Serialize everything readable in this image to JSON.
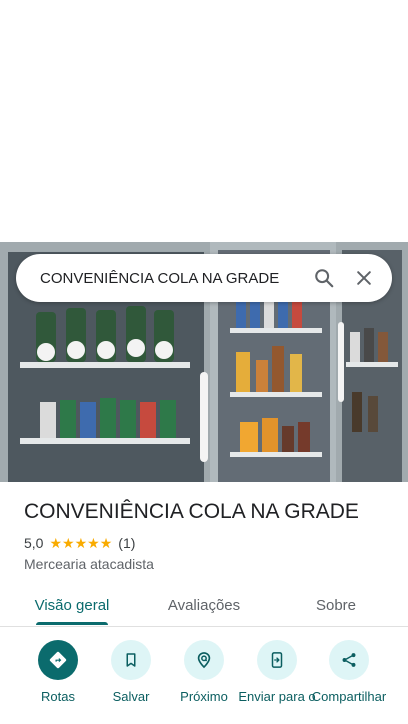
{
  "search": {
    "query": "CONVENIÊNCIA COLA NA GRADE"
  },
  "place": {
    "name": "CONVENIÊNCIA COLA NA GRADE",
    "rating": "5,0",
    "stars": 5,
    "review_count": "(1)",
    "category": "Mercearia atacadista"
  },
  "tabs": [
    {
      "label": "Visão geral",
      "active": true
    },
    {
      "label": "Avaliações",
      "active": false
    },
    {
      "label": "Sobre",
      "active": false
    }
  ],
  "actions": [
    {
      "label": "Rotas",
      "icon": "directions-icon"
    },
    {
      "label": "Salvar",
      "icon": "bookmark-icon"
    },
    {
      "label": "Próximo",
      "icon": "nearby-icon"
    },
    {
      "label": "Enviar para o",
      "icon": "send-to-phone-icon"
    },
    {
      "label": "Compartilhar",
      "icon": "share-icon"
    }
  ],
  "colors": {
    "accent": "#0b6b6d",
    "accent_light": "#def5f6",
    "star": "#f9ab00"
  }
}
